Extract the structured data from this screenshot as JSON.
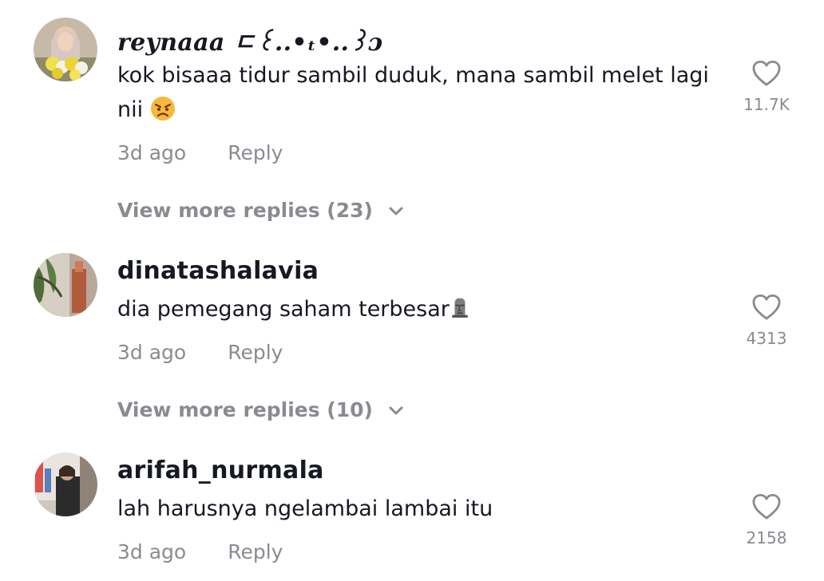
{
  "colors": {
    "text_primary": "#161823",
    "text_secondary": "#8a8b91",
    "background": "#ffffff"
  },
  "comments": [
    {
      "username": "reynaaa ㄷ꒰..•ₜ•..꒱ɔ",
      "text": "kok bisaaa tidur sambil duduk, mana sambil melet lagi nii",
      "emoji": "angry-face-emoji",
      "time": "3d ago",
      "reply_label": "Reply",
      "like_count": "11.7K",
      "more_replies": "View more replies (23)"
    },
    {
      "username": "dinatashalavia",
      "text": "dia pemegang saham terbesar",
      "emoji": "moai-emoji",
      "time": "3d ago",
      "reply_label": "Reply",
      "like_count": "4313",
      "more_replies": "View more replies (10)"
    },
    {
      "username": "arifah_nurmala",
      "text": "lah harusnya ngelambai lambai itu",
      "time": "3d ago",
      "reply_label": "Reply",
      "like_count": "2158"
    }
  ]
}
